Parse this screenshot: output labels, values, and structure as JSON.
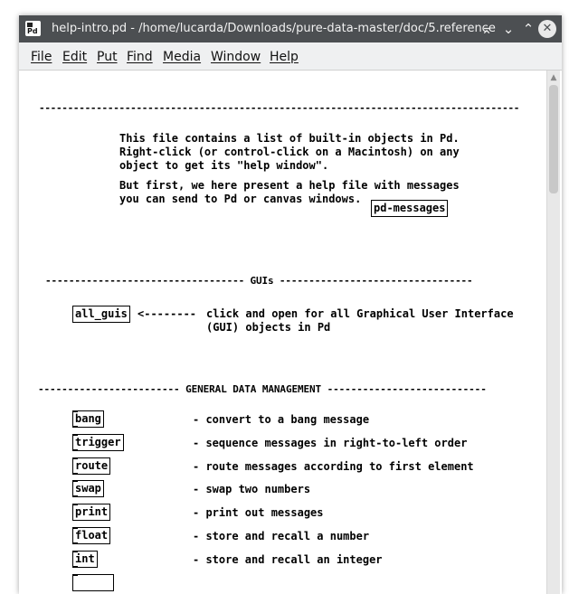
{
  "window": {
    "title": "help-intro.pd  - /home/lucarda/Downloads/pure-data-master/doc/5.reference",
    "app_icon_text": "Pd",
    "controls": {
      "keep_above": "⌅",
      "minimize": "⌄",
      "maximize": "⌃",
      "close": "✕"
    }
  },
  "menubar": {
    "items": [
      {
        "label": "File"
      },
      {
        "label": "Edit"
      },
      {
        "label": "Put"
      },
      {
        "label": "Find"
      },
      {
        "label": "Media"
      },
      {
        "label": "Window"
      },
      {
        "label": "Help"
      }
    ]
  },
  "canvas": {
    "rule_top": "------------------------------------------------------------------------------------",
    "intro_lines": [
      "This file contains a list of built-in objects in Pd.",
      "Right-click (or control-click on a Macintosh) on any",
      "object to get its \"help window\"."
    ],
    "first_lines": [
      "But first, we here present a help file with messages",
      "you can send to Pd or canvas windows."
    ],
    "pd_messages_box": "pd-messages",
    "guis_header": "---------------------------------- GUIs ---------------------------------",
    "all_guis_box": "all_guis",
    "all_guis_arrow": "<--------",
    "all_guis_desc": [
      "click and open for all Graphical User Interface",
      "(GUI) objects in Pd"
    ],
    "data_header": "------------------------ GENERAL DATA MANAGEMENT ---------------------------",
    "objects": [
      {
        "name": "bang",
        "desc": "- convert to a bang message"
      },
      {
        "name": "trigger",
        "desc": "- sequence messages in right-to-left order"
      },
      {
        "name": "route",
        "desc": "- route messages according to first element"
      },
      {
        "name": "swap",
        "desc": "- swap two numbers"
      },
      {
        "name": "print",
        "desc": "- print out messages"
      },
      {
        "name": "float",
        "desc": "- store and recall a number"
      },
      {
        "name": "int",
        "desc": "- store and recall an integer"
      }
    ]
  }
}
